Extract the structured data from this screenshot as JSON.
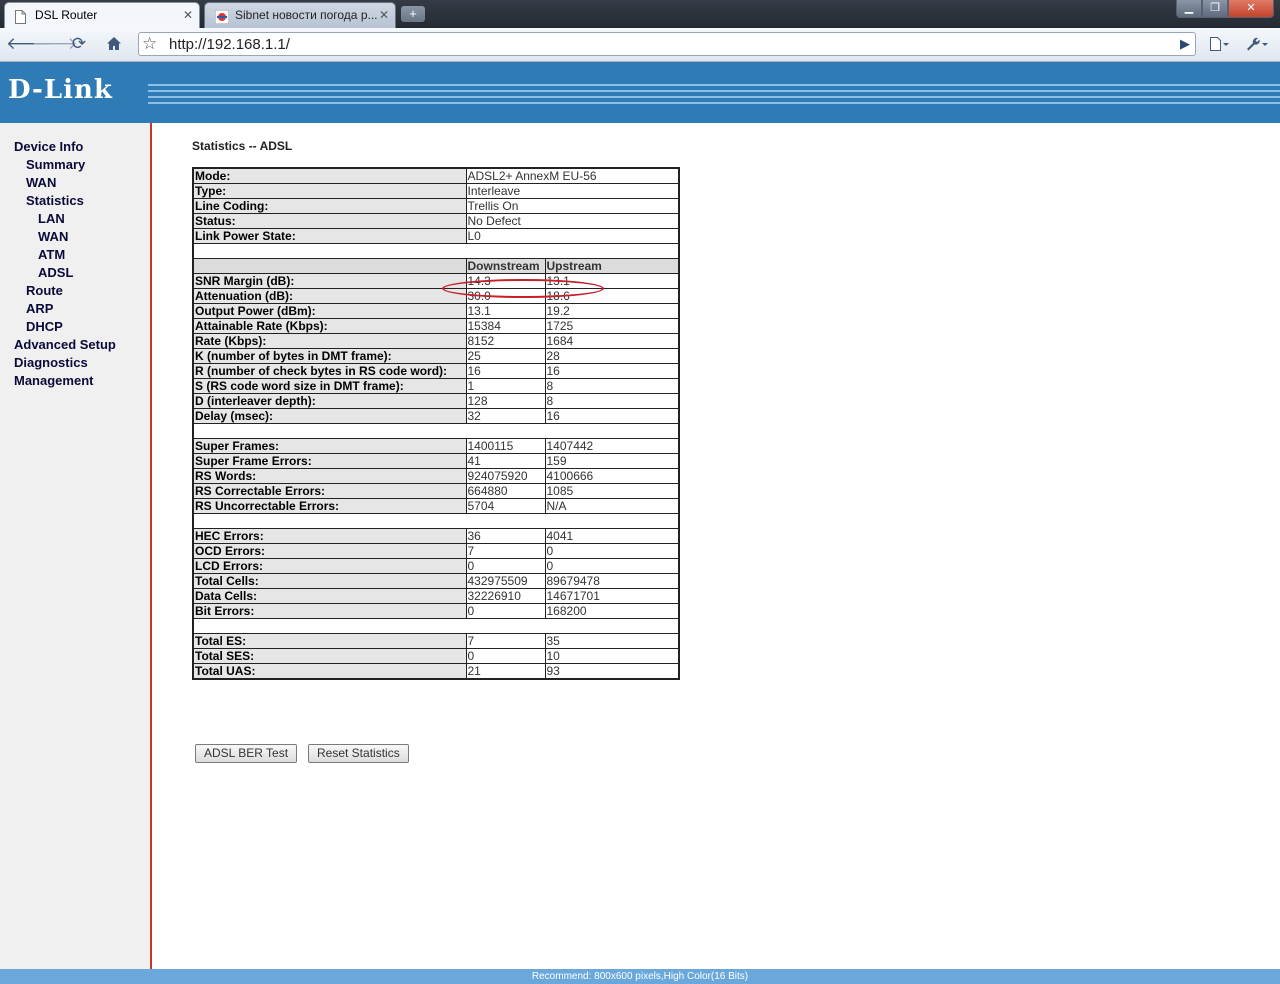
{
  "browser": {
    "tabs": [
      {
        "title": "DSL Router"
      },
      {
        "title": "Sibnet новости погода р..."
      }
    ],
    "new_tab": "+",
    "window_buttons": {
      "minimize": "▁",
      "maximize": "❐",
      "close": "✕"
    },
    "address": "http://192.168.1.1/"
  },
  "brand": {
    "logo": "D-Link"
  },
  "nav": {
    "device_info": "Device Info",
    "summary": "Summary",
    "wan": "WAN",
    "statistics": "Statistics",
    "stats_lan": "LAN",
    "stats_wan": "WAN",
    "stats_atm": "ATM",
    "stats_adsl": "ADSL",
    "route": "Route",
    "arp": "ARP",
    "dhcp": "DHCP",
    "advanced_setup": "Advanced Setup",
    "diagnostics": "Diagnostics",
    "management": "Management"
  },
  "page": {
    "title": "Statistics -- ADSL"
  },
  "table": {
    "info": [
      {
        "label": "Mode:",
        "value": "ADSL2+ AnnexM EU-56"
      },
      {
        "label": "Type:",
        "value": "Interleave"
      },
      {
        "label": "Line Coding:",
        "value": "Trellis On"
      },
      {
        "label": "Status:",
        "value": "No Defect"
      },
      {
        "label": "Link Power State:",
        "value": "L0"
      }
    ],
    "headers": {
      "down": "Downstream",
      "up": "Upstream"
    },
    "groups": [
      [
        {
          "label": "SNR Margin (dB):",
          "down": "14.3",
          "up": "13.1"
        },
        {
          "label": "Attenuation (dB):",
          "down": "30.0",
          "up": "18.6"
        },
        {
          "label": "Output Power (dBm):",
          "down": "13.1",
          "up": "19.2"
        },
        {
          "label": "Attainable Rate (Kbps):",
          "down": "15384",
          "up": "1725"
        },
        {
          "label": "Rate (Kbps):",
          "down": "8152",
          "up": "1684"
        },
        {
          "label": "K (number of bytes in DMT frame):",
          "down": "25",
          "up": "28"
        },
        {
          "label": "R (number of check bytes in RS code word):",
          "down": "16",
          "up": "16"
        },
        {
          "label": "S (RS code word size in DMT frame):",
          "down": "1",
          "up": "8"
        },
        {
          "label": "D (interleaver depth):",
          "down": "128",
          "up": "8"
        },
        {
          "label": "Delay (msec):",
          "down": "32",
          "up": "16"
        }
      ],
      [
        {
          "label": "Super Frames:",
          "down": "1400115",
          "up": "1407442"
        },
        {
          "label": "Super Frame Errors:",
          "down": "41",
          "up": "159"
        },
        {
          "label": "RS Words:",
          "down": "924075920",
          "up": "4100666"
        },
        {
          "label": "RS Correctable Errors:",
          "down": "664880",
          "up": "1085"
        },
        {
          "label": "RS Uncorrectable Errors:",
          "down": "5704",
          "up": "N/A"
        }
      ],
      [
        {
          "label": "HEC Errors:",
          "down": "36",
          "up": "4041"
        },
        {
          "label": "OCD Errors:",
          "down": "7",
          "up": "0"
        },
        {
          "label": "LCD Errors:",
          "down": "0",
          "up": "0"
        },
        {
          "label": "Total Cells:",
          "down": "432975509",
          "up": "89679478"
        },
        {
          "label": "Data Cells:",
          "down": "32226910",
          "up": "14671701"
        },
        {
          "label": "Bit Errors:",
          "down": "0",
          "up": "168200"
        }
      ],
      [
        {
          "label": "Total ES:",
          "down": "7",
          "up": "35"
        },
        {
          "label": "Total SES:",
          "down": "0",
          "up": "10"
        },
        {
          "label": "Total UAS:",
          "down": "21",
          "up": "93"
        }
      ]
    ]
  },
  "buttons": {
    "ber_test": "ADSL BER Test",
    "reset": "Reset Statistics"
  },
  "status_bar": "Recommend: 800x600 pixels,High Color(16 Bits)",
  "colors": {
    "banner": "#2f7bb5",
    "sidebar_border": "#c0392b",
    "highlight": "#c8202a",
    "status_bar": "#6aa8dc"
  },
  "icons": {
    "back": "back-arrow-icon",
    "forward": "forward-arrow-icon",
    "reload": "reload-icon",
    "home": "home-icon",
    "bookmark": "star-icon",
    "page": "page-menu-icon",
    "tools": "wrench-icon"
  }
}
